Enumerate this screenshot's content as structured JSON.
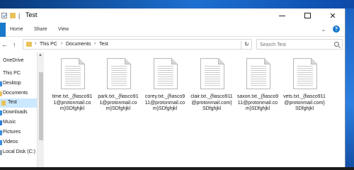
{
  "window": {
    "title": "Test"
  },
  "ribbon": {
    "tabs": [
      "Home",
      "Share",
      "View"
    ]
  },
  "address": {
    "crumbs": [
      "This PC",
      "Documents",
      "Test"
    ]
  },
  "search": {
    "placeholder": "Search Test"
  },
  "nav": {
    "items": [
      {
        "label": "OneDrive"
      },
      {
        "label": "This PC"
      },
      {
        "label": "Desktop"
      },
      {
        "label": "Documents"
      },
      {
        "label": "Test"
      },
      {
        "label": "Downloads"
      },
      {
        "label": "Music"
      },
      {
        "label": "Pictures"
      },
      {
        "label": "Videos"
      },
      {
        "label": "Local Disk (C:)"
      }
    ]
  },
  "files": [
    {
      "name": "time.txt._{fiasco911@protonmail.com}SDfghjkl"
    },
    {
      "name": "park.txt._{fiasco911@protonmail.com}SDfghjkl"
    },
    {
      "name": "corey.txt._{fiasco911@protonmail.com}SDfghjkl"
    },
    {
      "name": "clair.txt._{fiasco911@protonmail.com}SDfghjkl"
    },
    {
      "name": "saxon.txt._{fiasco911@protonmail.com}SDfghjkl"
    },
    {
      "name": "vets.txt._{fiasco911@protonmail.com}SDfghjkl"
    }
  ],
  "colors": {
    "accent": "#1979ca",
    "selection": "#cce8ff",
    "folder": "#e8c25a"
  }
}
